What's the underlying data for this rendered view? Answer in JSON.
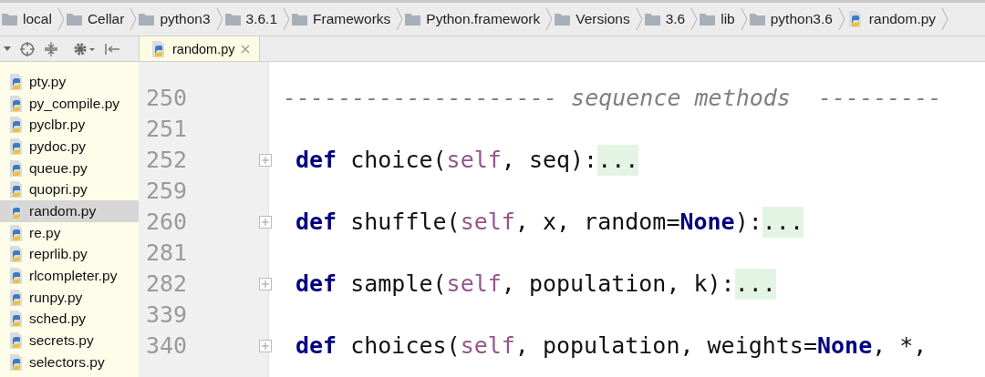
{
  "breadcrumbs": [
    {
      "label": "local",
      "kind": "folder"
    },
    {
      "label": "Cellar",
      "kind": "folder"
    },
    {
      "label": "python3",
      "kind": "folder"
    },
    {
      "label": "3.6.1",
      "kind": "folder"
    },
    {
      "label": "Frameworks",
      "kind": "folder"
    },
    {
      "label": "Python.framework",
      "kind": "folder"
    },
    {
      "label": "Versions",
      "kind": "folder"
    },
    {
      "label": "3.6",
      "kind": "folder"
    },
    {
      "label": "lib",
      "kind": "folder"
    },
    {
      "label": "python3.6",
      "kind": "folder"
    },
    {
      "label": "random.py",
      "kind": "file"
    }
  ],
  "editor_tab": {
    "label": "random.py",
    "selected": true
  },
  "sidebar": {
    "items": [
      {
        "label": "pty.py",
        "selected": false
      },
      {
        "label": "py_compile.py",
        "selected": false
      },
      {
        "label": "pyclbr.py",
        "selected": false
      },
      {
        "label": "pydoc.py",
        "selected": false
      },
      {
        "label": "queue.py",
        "selected": false
      },
      {
        "label": "quopri.py",
        "selected": false
      },
      {
        "label": "random.py",
        "selected": true
      },
      {
        "label": "re.py",
        "selected": false
      },
      {
        "label": "reprlib.py",
        "selected": false
      },
      {
        "label": "rlcompleter.py",
        "selected": false
      },
      {
        "label": "runpy.py",
        "selected": false
      },
      {
        "label": "sched.py",
        "selected": false
      },
      {
        "label": "secrets.py",
        "selected": false
      },
      {
        "label": "selectors.py",
        "selected": false
      }
    ]
  },
  "editor": {
    "lines": [
      {
        "number": "250",
        "folded": false,
        "tokens": [
          {
            "kind": "comment",
            "text": "-------------------- sequence methods  ---------"
          }
        ]
      },
      {
        "number": "251",
        "folded": false
      },
      {
        "number": "252",
        "folded": true,
        "tokens": [
          {
            "kind": "keyword",
            "text": "def"
          },
          {
            "kind": "plain",
            "text": " choice("
          },
          {
            "kind": "self",
            "text": "self"
          },
          {
            "kind": "plain",
            "text": ", seq):"
          },
          {
            "kind": "fold",
            "text": "..."
          }
        ]
      },
      {
        "number": "259",
        "folded": false
      },
      {
        "number": "260",
        "folded": true,
        "tokens": [
          {
            "kind": "keyword",
            "text": "def"
          },
          {
            "kind": "plain",
            "text": " shuffle("
          },
          {
            "kind": "self",
            "text": "self"
          },
          {
            "kind": "plain",
            "text": ", x, random="
          },
          {
            "kind": "keyword",
            "text": "None"
          },
          {
            "kind": "plain",
            "text": "):"
          },
          {
            "kind": "fold",
            "text": "..."
          }
        ]
      },
      {
        "number": "281",
        "folded": false
      },
      {
        "number": "282",
        "folded": true,
        "tokens": [
          {
            "kind": "keyword",
            "text": "def"
          },
          {
            "kind": "plain",
            "text": " sample("
          },
          {
            "kind": "self",
            "text": "self"
          },
          {
            "kind": "plain",
            "text": ", population, k):"
          },
          {
            "kind": "fold",
            "text": "..."
          }
        ]
      },
      {
        "number": "339",
        "folded": false
      },
      {
        "number": "340",
        "folded": true,
        "tokens": [
          {
            "kind": "keyword",
            "text": "def"
          },
          {
            "kind": "plain",
            "text": " choices("
          },
          {
            "kind": "self",
            "text": "self"
          },
          {
            "kind": "plain",
            "text": ", population, weights="
          },
          {
            "kind": "keyword",
            "text": "None"
          },
          {
            "kind": "plain",
            "text": ", *,"
          }
        ]
      }
    ]
  }
}
